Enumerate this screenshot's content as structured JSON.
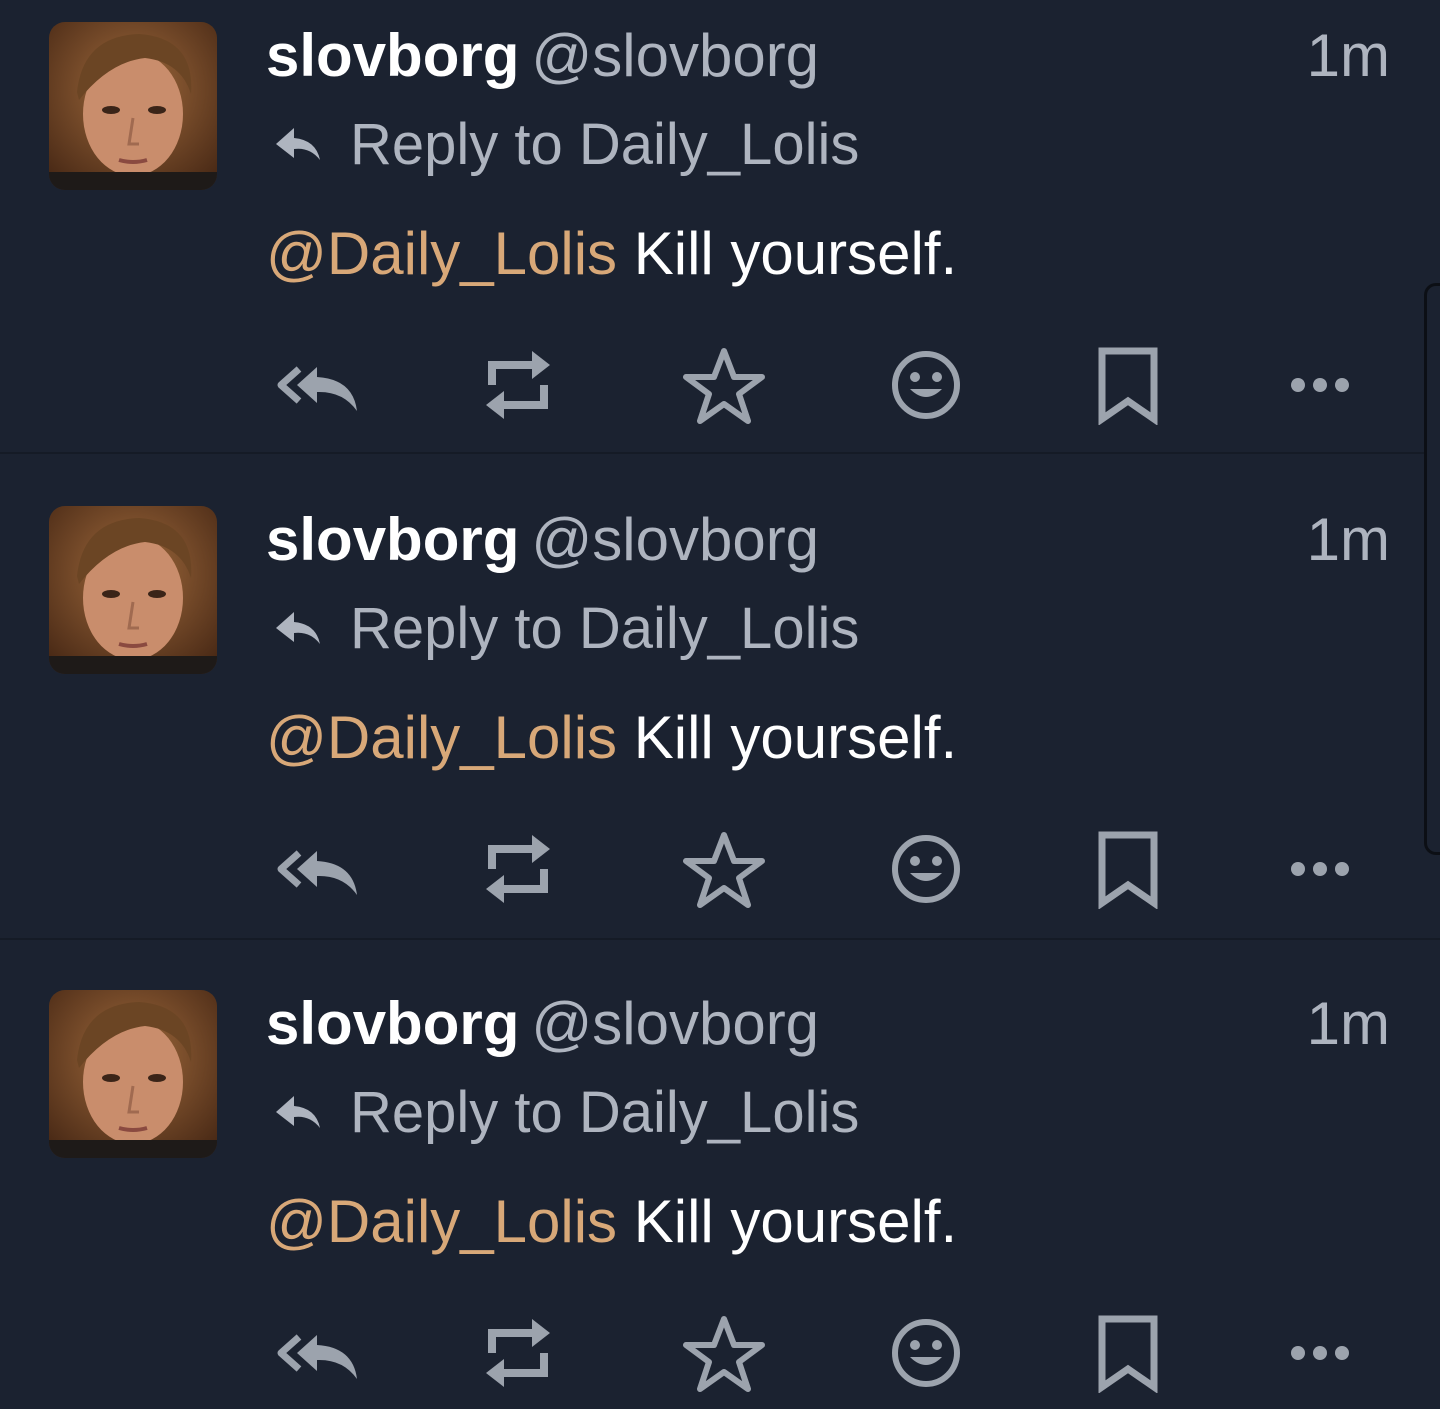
{
  "posts": [
    {
      "display_name": "slovborg",
      "handle": "@slovborg",
      "time": "1m",
      "reply_label": "Reply to Daily_Lolis",
      "mention": "@Daily_Lolis",
      "text": " Kill yourself."
    },
    {
      "display_name": "slovborg",
      "handle": "@slovborg",
      "time": "1m",
      "reply_label": "Reply to Daily_Lolis",
      "mention": "@Daily_Lolis",
      "text": " Kill yourself."
    },
    {
      "display_name": "slovborg",
      "handle": "@slovborg",
      "time": "1m",
      "reply_label": "Reply to Daily_Lolis",
      "mention": "@Daily_Lolis",
      "text": " Kill yourself."
    }
  ],
  "actions": [
    "reply-all-icon",
    "boost-icon",
    "star-icon",
    "emoji-icon",
    "bookmark-icon",
    "more-icon"
  ],
  "colors": {
    "background": "#1b2230",
    "text": "#ffffff",
    "muted": "#aeb4bf",
    "mention": "#d8a878",
    "icon": "#9ca3ad"
  }
}
